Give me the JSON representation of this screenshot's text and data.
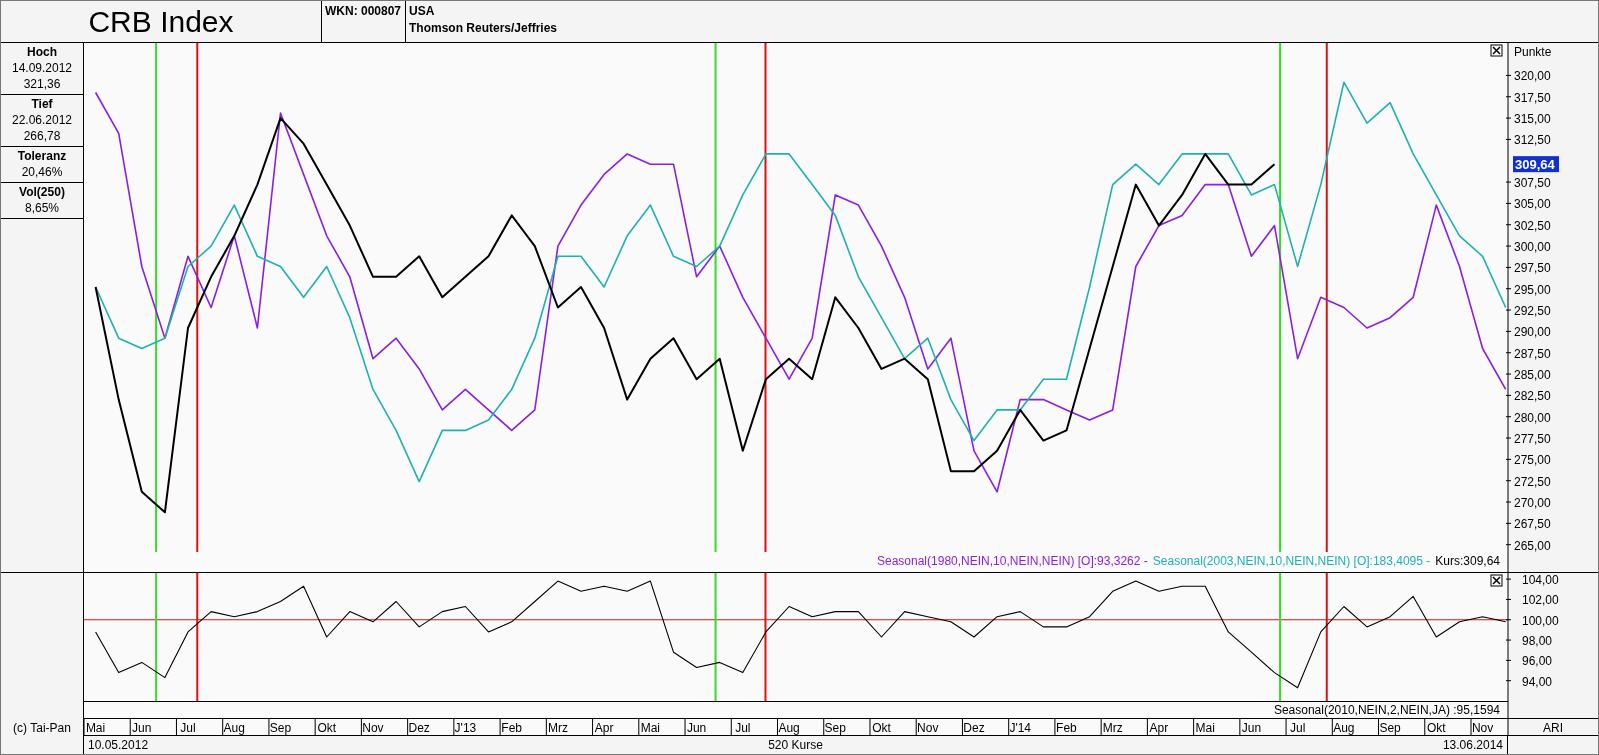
{
  "header": {
    "title": "CRB Index",
    "wkn": "WKN: 000807",
    "country": "USA",
    "source": "Thomson Reuters/Jeffries"
  },
  "stats": [
    {
      "label": "Hoch",
      "lines": [
        "14.09.2012",
        "321,36"
      ]
    },
    {
      "label": "Tief",
      "lines": [
        "22.06.2012",
        "266,78"
      ]
    },
    {
      "label": "Toleranz",
      "lines": [
        "20,46%"
      ]
    },
    {
      "label": "Vol(250)",
      "lines": [
        "8,65%"
      ]
    }
  ],
  "main_chart": {
    "unit": "Punkte",
    "legend": [
      {
        "suffix": " [O]:93,3262 -"
      },
      {
        "suffix": " [O]:183,4095 -"
      },
      {
        "suffix": ":309,64"
      }
    ],
    "chart_data": {
      "type": "line",
      "grid": true,
      "ylim": [
        261.8,
        323.8
      ],
      "categories": [
        null,
        null,
        null,
        null,
        null,
        null,
        null,
        null,
        null,
        null,
        null,
        null,
        null,
        null,
        null,
        null,
        null,
        null,
        null,
        null,
        null,
        null,
        null,
        null,
        null,
        null,
        null,
        null,
        null,
        null,
        null,
        null,
        null,
        null,
        null,
        null,
        null,
        null,
        null,
        null,
        null,
        null,
        null,
        null,
        null,
        null,
        null,
        null,
        null,
        null,
        null,
        null,
        null,
        null,
        null,
        null,
        null,
        null,
        null,
        null,
        null,
        null
      ],
      "yticks": [
        {
          "value": 265,
          "label": "265,00"
        },
        {
          "value": 267.5,
          "label": "267,50"
        },
        {
          "value": 270,
          "label": "270,00"
        },
        {
          "value": 272.5,
          "label": "272,50"
        },
        {
          "value": 275,
          "label": "275,00"
        },
        {
          "value": 277.5,
          "label": "277,50"
        },
        {
          "value": 280,
          "label": "280,00"
        },
        {
          "value": 282.5,
          "label": "282,50"
        },
        {
          "value": 285,
          "label": "285,00"
        },
        {
          "value": 287.5,
          "label": "287,50"
        },
        {
          "value": 290,
          "label": "290,00"
        },
        {
          "value": 292.5,
          "label": "292,50"
        },
        {
          "value": 295,
          "label": "295,00"
        },
        {
          "value": 297.5,
          "label": "297,50"
        },
        {
          "value": 300,
          "label": "300,00"
        },
        {
          "value": 302.5,
          "label": "302,50"
        },
        {
          "value": 305,
          "label": "305,00"
        },
        {
          "value": 307.5,
          "label": "307,50"
        },
        {
          "value": 312.5,
          "label": "312,50"
        },
        {
          "value": 315,
          "label": "315,00"
        },
        {
          "value": 317.5,
          "label": "317,50"
        },
        {
          "value": 320,
          "label": "320,00"
        }
      ],
      "series": [
        {
          "name": "Seasonal(1980,NEIN,10,NEIN,NEIN)",
          "color": "#8a1fe0",
          "values": [
            318.0,
            313.2,
            297.6,
            289.2,
            298.8,
            292.8,
            301.2,
            290.4,
            315.6,
            308.4,
            301.2,
            296.4,
            286.8,
            289.2,
            285.6,
            280.8,
            283.2,
            280.8,
            278.4,
            280.8,
            300.0,
            304.8,
            308.4,
            310.8,
            309.6,
            309.6,
            296.4,
            300.0,
            294.0,
            289.2,
            284.4,
            289.2,
            306.0,
            304.8,
            300.0,
            294.0,
            285.6,
            289.2,
            276.0,
            271.2,
            282.0,
            282.0,
            280.8,
            279.6,
            280.8,
            297.6,
            302.4,
            303.6,
            307.2,
            307.2,
            298.8,
            302.4,
            286.8,
            294.0,
            292.8,
            290.4,
            291.6,
            294.0,
            304.8,
            297.6,
            288.0,
            283.2
          ]
        },
        {
          "name": "Seasonal(2003,NEIN,10,NEIN,NEIN)",
          "color": "#1fb0b0",
          "values": [
            295.2,
            289.2,
            288.0,
            289.2,
            297.6,
            300.0,
            304.8,
            298.8,
            297.6,
            294.0,
            297.6,
            291.6,
            283.2,
            278.4,
            272.4,
            278.4,
            278.4,
            279.6,
            283.2,
            289.2,
            298.8,
            298.8,
            295.2,
            301.2,
            304.8,
            298.8,
            297.6,
            300.0,
            306.0,
            310.8,
            310.8,
            307.2,
            303.6,
            296.4,
            291.6,
            286.8,
            289.2,
            282.0,
            277.2,
            280.8,
            280.8,
            284.4,
            284.4,
            295.2,
            307.2,
            309.6,
            307.2,
            310.8,
            310.8,
            310.8,
            306.0,
            307.2,
            297.6,
            307.2,
            319.2,
            314.4,
            316.8,
            310.8,
            306.0,
            301.2,
            298.8,
            292.8
          ]
        },
        {
          "name": "Kurs",
          "color": "#000000",
          "values": [
            295.2,
            282.0,
            271.2,
            268.8,
            290.4,
            296.4,
            301.2,
            307.2,
            315.0,
            312.0,
            307.2,
            302.4,
            296.4,
            296.4,
            298.8,
            294.0,
            296.4,
            298.8,
            303.6,
            300.0,
            292.8,
            295.2,
            290.4,
            282.0,
            286.8,
            289.2,
            284.4,
            286.8,
            276.0,
            284.4,
            286.8,
            284.4,
            294.0,
            290.4,
            285.6,
            286.8,
            284.4,
            273.6,
            273.6,
            276.0,
            280.8,
            277.2,
            278.4,
            288.0,
            297.6,
            307.2,
            302.4,
            306.0,
            310.8,
            307.2,
            307.2,
            309.6,
            null,
            null,
            null,
            null,
            null,
            null,
            null,
            null,
            null,
            null
          ]
        }
      ],
      "annotations": [
        "309,64"
      ]
    }
  },
  "lower_chart": {
    "legend": [
      {
        "suffix": " :95,1594"
      }
    ],
    "chart_data": {
      "type": "line",
      "grid": true,
      "ylim": [
        92.0,
        104.7
      ],
      "categories": [
        "Mai",
        null,
        "Jun",
        null,
        "Jul",
        null,
        "Aug",
        null,
        "Sep",
        null,
        "Okt",
        null,
        "Nov",
        null,
        "Dez",
        null,
        "J'13",
        null,
        "Feb",
        null,
        "Mrz",
        null,
        "Apr",
        null,
        "Mai",
        null,
        "Jun",
        null,
        "Jul",
        null,
        "Aug",
        null,
        "Sep",
        null,
        "Okt",
        null,
        "Nov",
        null,
        "Dez",
        null,
        "J'14",
        null,
        "Feb",
        null,
        "Mrz",
        null,
        "Apr",
        null,
        "Mai",
        null,
        "Jun",
        null,
        "Jul",
        null,
        "Aug",
        null,
        "Sep",
        null,
        "Okt",
        null,
        "Nov",
        null
      ],
      "yticks": [
        {
          "value": 94,
          "label": "94,00"
        },
        {
          "value": 96,
          "label": "96,00"
        },
        {
          "value": 98,
          "label": "98,00"
        },
        {
          "value": 100,
          "label": "100,00"
        },
        {
          "value": 102,
          "label": "102,00"
        },
        {
          "value": 104,
          "label": "104,00"
        }
      ],
      "series": [
        {
          "name": "Seasonal(2010,NEIN,2,NEIN,JA)",
          "color": "#000000",
          "values": [
            98.8,
            94.8,
            95.8,
            94.3,
            98.8,
            100.8,
            100.3,
            100.8,
            101.8,
            103.3,
            98.3,
            100.8,
            99.8,
            101.8,
            99.3,
            100.8,
            101.3,
            98.8,
            99.8,
            101.8,
            103.8,
            102.8,
            103.3,
            102.8,
            103.8,
            96.8,
            95.3,
            95.8,
            94.8,
            98.8,
            101.3,
            100.3,
            100.8,
            100.8,
            98.3,
            100.8,
            100.3,
            99.8,
            98.3,
            100.3,
            100.8,
            99.3,
            99.3,
            100.3,
            102.8,
            103.8,
            102.8,
            103.3,
            103.3,
            98.8,
            96.8,
            94.8,
            93.3,
            98.8,
            101.3,
            99.3,
            100.3,
            102.3,
            98.3,
            99.8,
            100.3,
            99.8
          ]
        }
      ],
      "ref_lines": [
        {
          "axis": "y",
          "value": 100,
          "color": "#dd1111"
        }
      ]
    }
  },
  "footer": {
    "copyright": "(c) Tai-Pan",
    "axis_unit": "ARI",
    "start_date": "10.05.2012",
    "count": "520 Kurse",
    "end_date": "13.06.2014"
  }
}
